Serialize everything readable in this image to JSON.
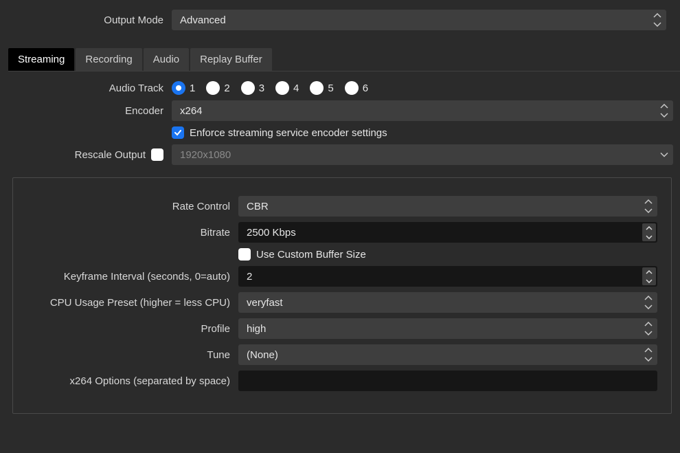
{
  "top": {
    "output_mode_label": "Output Mode",
    "output_mode_value": "Advanced"
  },
  "tabs": [
    "Streaming",
    "Recording",
    "Audio",
    "Replay Buffer"
  ],
  "stream": {
    "audio_track_label": "Audio Track",
    "tracks": [
      "1",
      "2",
      "3",
      "4",
      "5",
      "6"
    ],
    "encoder_label": "Encoder",
    "encoder_value": "x264",
    "enforce_label": "Enforce streaming service encoder settings",
    "rescale_label": "Rescale Output",
    "rescale_value": "1920x1080"
  },
  "enc": {
    "rate_control_label": "Rate Control",
    "rate_control_value": "CBR",
    "bitrate_label": "Bitrate",
    "bitrate_value": "2500 Kbps",
    "custom_buffer_label": "Use Custom Buffer Size",
    "keyframe_label": "Keyframe Interval (seconds, 0=auto)",
    "keyframe_value": "2",
    "cpu_preset_label": "CPU Usage Preset (higher = less CPU)",
    "cpu_preset_value": "veryfast",
    "profile_label": "Profile",
    "profile_value": "high",
    "tune_label": "Tune",
    "tune_value": "(None)",
    "x264_opts_label": "x264 Options (separated by space)",
    "x264_opts_value": ""
  }
}
